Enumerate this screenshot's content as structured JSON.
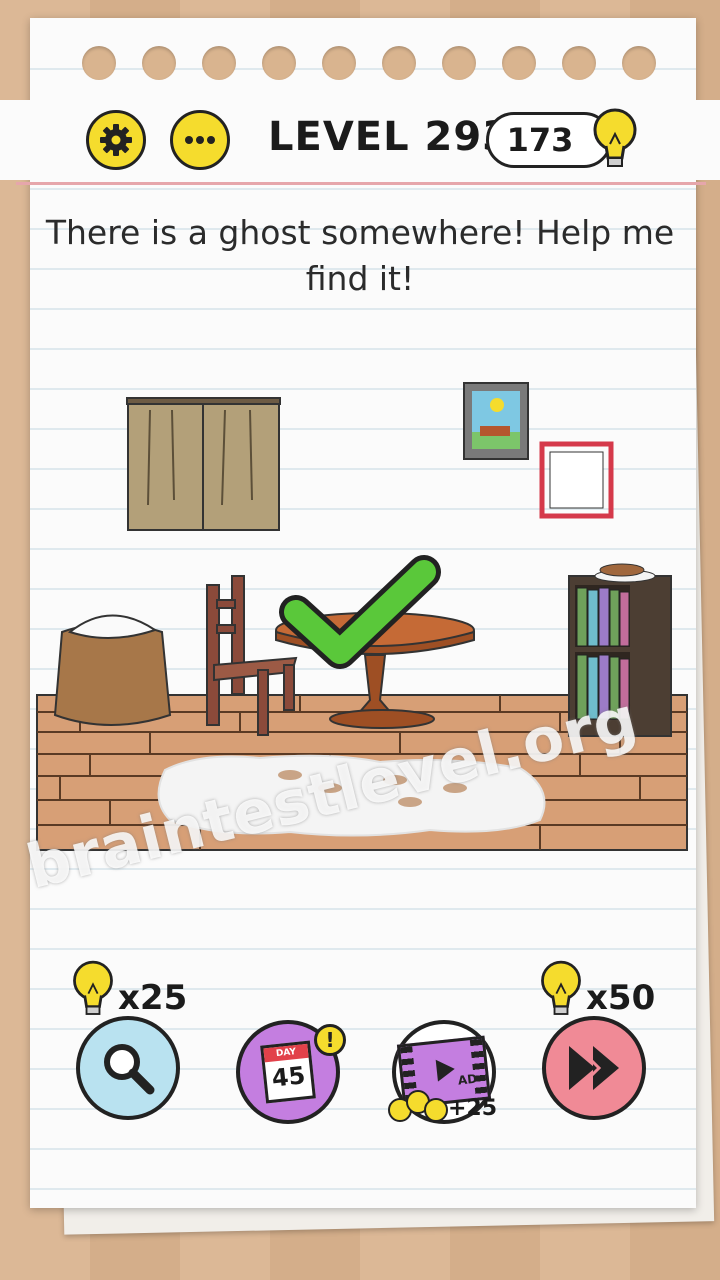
{
  "header": {
    "level_label": "LEVEL 293",
    "coins": "173"
  },
  "question": "There is a ghost somewhere! Help me find it!",
  "tools": {
    "hint_cost": "x25",
    "skip_cost": "x50",
    "daily_day_label": "DAY",
    "daily_day": "45",
    "daily_badge": "!",
    "ad_label": "AD",
    "ad_reward": "+25"
  },
  "watermark": "braintestlevel.org",
  "icons": [
    "gear-icon",
    "more-icon",
    "lightbulb-icon",
    "search-icon",
    "calendar-icon",
    "video-ad-icon",
    "skip-icon",
    "checkmark-icon"
  ],
  "colors": {
    "accent_yellow": "#f5dc2d",
    "hint_blue": "#b9e2f0",
    "daily_purple": "#c47ee0",
    "skip_pink": "#f08a96",
    "check_green": "#5ac83a"
  }
}
